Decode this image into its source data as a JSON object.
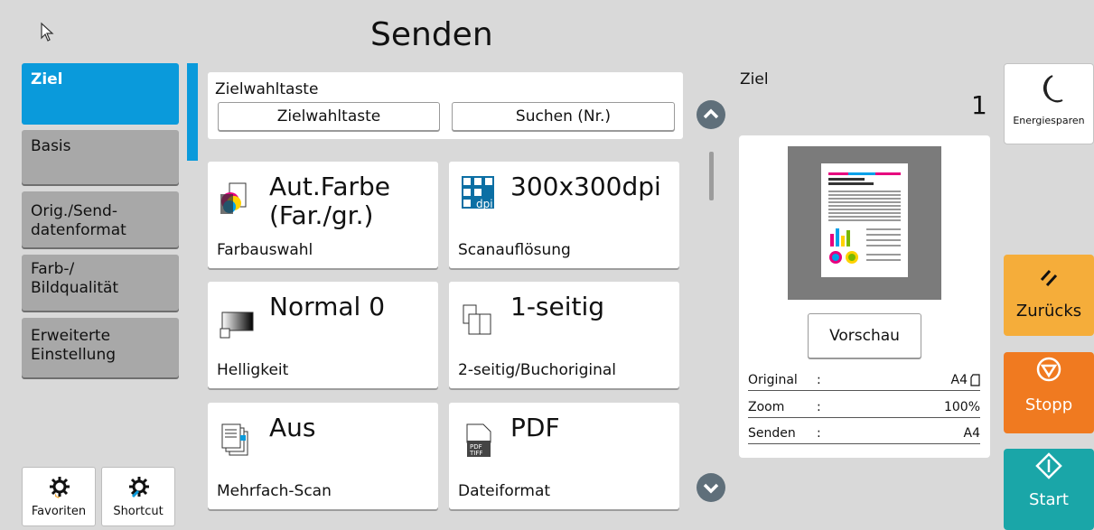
{
  "header": {
    "title": "Senden"
  },
  "tabs": [
    {
      "label": "Ziel"
    },
    {
      "label": "Basis"
    },
    {
      "label": "Orig./Send-\ndatenformat"
    },
    {
      "label": "Farb-/\nBildqualität"
    },
    {
      "label": "Erweiterte\nEinstellung"
    }
  ],
  "bottom_left": {
    "favoriten": "Favoriten",
    "shortcut": "Shortcut"
  },
  "destination": {
    "label": "Zielwahltaste",
    "btn_zielwahl": "Zielwahltaste",
    "btn_suchen": "Suchen (Nr.)"
  },
  "cards": [
    {
      "value": "Aut.Farbe\n(Far./gr.)",
      "label": "Farbauswahl",
      "icon": "color-select-icon"
    },
    {
      "value": "300x300dpi",
      "label": "Scanauflösung",
      "icon": "dpi-icon"
    },
    {
      "value": "Normal 0",
      "label": "Helligkeit",
      "icon": "brightness-icon"
    },
    {
      "value": "1-seitig",
      "label": "2-seitig/Buchoriginal",
      "icon": "duplex-icon"
    },
    {
      "value": "Aus",
      "label": "Mehrfach-Scan",
      "icon": "multi-scan-icon"
    },
    {
      "value": "PDF",
      "label": "Dateiformat",
      "icon": "pdf-tiff-icon"
    }
  ],
  "preview": {
    "ziel_label": "Ziel",
    "count": "1",
    "vorschau": "Vorschau",
    "rows": [
      {
        "key": "Original",
        "colon": ":",
        "value": "A4"
      },
      {
        "key": "Zoom",
        "colon": ":",
        "value": "100%"
      },
      {
        "key": "Senden",
        "colon": ":",
        "value": "A4"
      }
    ]
  },
  "actions": {
    "energiesparen": "Energiesparen",
    "zuruecksetzen": "Zurücks",
    "stopp": "Stopp",
    "start": "Start"
  },
  "colors": {
    "accent": "#0a9adb",
    "orange": "#f5ad3a",
    "stop": "#f07a20",
    "start": "#1aa6a8"
  }
}
